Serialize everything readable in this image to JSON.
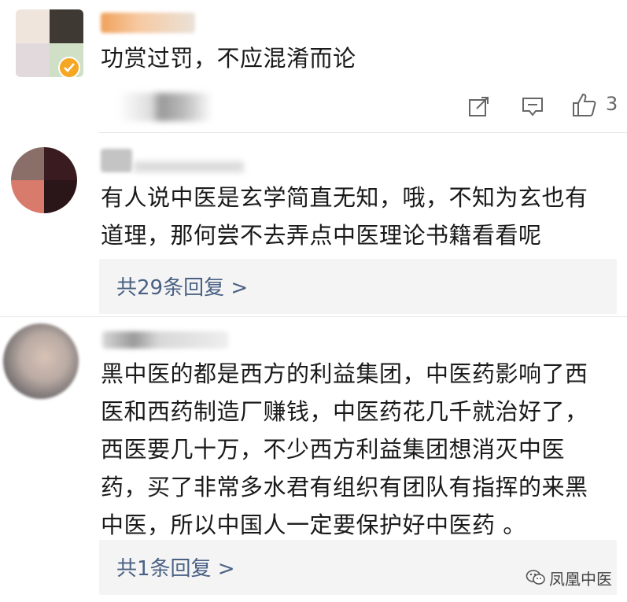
{
  "comments": [
    {
      "text": "功赏过罚，不应混淆而论",
      "like_count": "3"
    },
    {
      "text": "有人说中医是玄学简直无知，哦，不知为玄也有\n道理，那何尝不去弄点中医理论书籍看看呢",
      "reply_label": "共29条回复 >"
    },
    {
      "text": "黑中医的都是西方的利益集团，中医药影响了西\n医和西药制造厂赚钱，中医药花几千就治好了，\n西医要几十万，不少西方利益集团想消灭中医\n药，买了非常多水君有组织有团队有指挥的来黑\n中医，所以中国人一定要保护好中医药 。",
      "reply_label": "共1条回复 >"
    }
  ],
  "watermark": {
    "text": "凤凰中医"
  },
  "colors": {
    "link": "#4a6184",
    "reply_bg": "#f4f4f4",
    "verified_badge": "#f5a623"
  }
}
